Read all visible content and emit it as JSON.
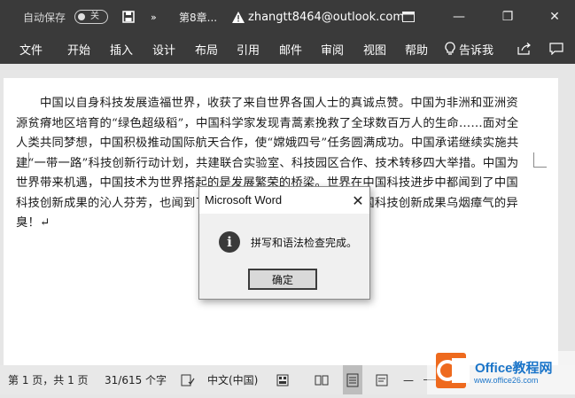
{
  "titlebar": {
    "autosave_label": "自动保存",
    "autosave_state": "关",
    "more_glyph": "»",
    "doc_title": "第8章...",
    "account": "zhangtt8464@outlook.com",
    "minimize_glyph": "—",
    "restore_glyph": "❐",
    "close_glyph": "✕"
  },
  "ribbon": {
    "tabs": [
      "文件",
      "开始",
      "插入",
      "设计",
      "布局",
      "引用",
      "邮件",
      "审阅",
      "视图",
      "帮助"
    ],
    "tell_me": "告诉我"
  },
  "document": {
    "paragraph": "中国以自身科技发展造福世界，收获了来自世界各国人士的真诚点赞。中国为非洲和亚洲资源贫瘠地区培育的“绿色超级稻”，中国科学家发现青蒿素挽救了全球数百万人的生命……面对全人类共同梦想，中国积极推动国际航天合作，使“嫦娥四号”任务圆满成功。中国承诺继续实施共建“一带一路”科技创新行动计划，共建联合实验室、科技园区合作、技术转移四大举措。中国为世界带来机遇，中国技术为世界搭起的是发展繁荣的桥梁。世界在中国科技进步中都闻到了中国科技创新成果的沁人芬芳，也闻到了美国一些人肆意抹黑、诬陷中国科技创新成果乌烟瘴气的异臭！↵"
  },
  "dialog": {
    "title": "Microsoft Word",
    "close_glyph": "✕",
    "info_glyph": "i",
    "message": "拼写和语法检查完成。",
    "ok_label": "确定"
  },
  "statusbar": {
    "page": "第 1 页，共 1 页",
    "words": "31/615 个字",
    "language": "中文(中国)",
    "zoom_minus": "—"
  },
  "watermark": {
    "brand": "Office教程网",
    "url": "www.office26.com"
  },
  "colors": {
    "titlebar_bg": "#3a3a3a",
    "statusbar_bg": "#e8e8e8",
    "watermark_orange": "#ee6a1e",
    "watermark_blue": "#1b75c9"
  }
}
